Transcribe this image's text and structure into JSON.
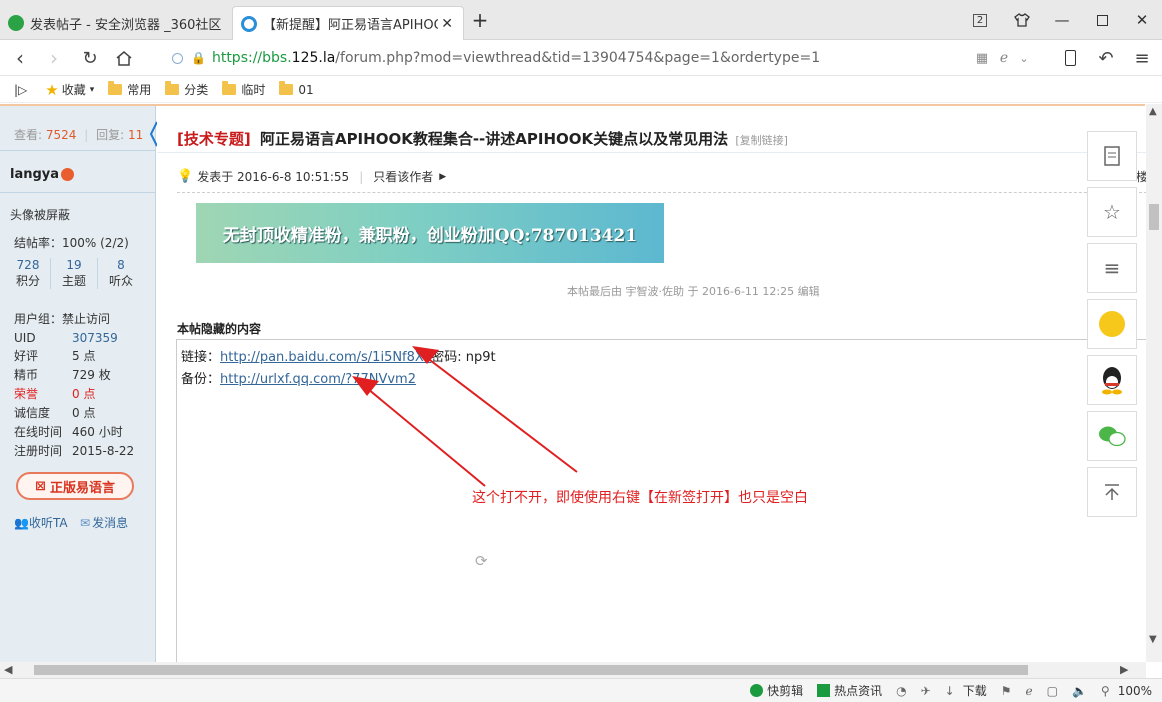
{
  "browser": {
    "tabs": [
      {
        "title": "发表帖子 - 安全浏览器 _360社区",
        "active": false
      },
      {
        "title": "【新提醒】阿正易语言APIHOOK",
        "active": true
      }
    ],
    "window_badge": "2",
    "url_prefix": "https://bbs.",
    "url_domain": "125.la",
    "url_rest": "/forum.php?mod=viewthread&tid=13904754&page=1&ordertype=1",
    "bookmarks": {
      "favorites_label": "收藏",
      "folders": [
        "常用",
        "分类",
        "临时",
        "01"
      ]
    }
  },
  "sidebar": {
    "views_label": "查看:",
    "views": "7524",
    "replies_label": "回复:",
    "replies": "11",
    "username": "langya",
    "avatar_text": "头像被屏蔽",
    "completion": "结帖率：100% (2/2)",
    "stats": [
      {
        "value": "728",
        "label": "积分"
      },
      {
        "value": "19",
        "label": "主题"
      },
      {
        "value": "8",
        "label": "听众"
      }
    ],
    "user_group": "用户组：禁止访问",
    "info": [
      {
        "k": "UID",
        "v": "307359",
        "link": true,
        "red": false
      },
      {
        "k": "好评",
        "v": "5 点",
        "link": false,
        "red": false
      },
      {
        "k": "精币",
        "v": "729 枚",
        "link": false,
        "red": false
      },
      {
        "k": "荣誉",
        "v": "0 点",
        "link": false,
        "red": true
      },
      {
        "k": "诚信度",
        "v": "0 点",
        "link": false,
        "red": false
      },
      {
        "k": "在线时间",
        "v": "460 小时",
        "link": false,
        "red": false
      },
      {
        "k": "注册时间",
        "v": "2015-8-22",
        "link": false,
        "red": false
      }
    ],
    "badge": "正版易语言",
    "follow": "收听TA",
    "message": "发消息"
  },
  "post": {
    "category": "[技术专题]",
    "title": "阿正易语言APIHOOK教程集合--讲述APIHOOK关键点以及常见用法",
    "copy_link": "[复制链接]",
    "posted_at": "发表于 2016-6-8 10:51:55",
    "only_author": "只看该作者",
    "floor_hint": "楼",
    "banner_text": "无封顶收精准粉，兼职粉，创业粉加QQ:787013421",
    "edit_note": "本帖最后由 宇智波·佐助 于 2016-6-11 12:25 编辑",
    "hidden_title": "本帖隐藏的内容",
    "link_label": "链接：",
    "link_url": "http://pan.baidu.com/s/1i5Nf8Xe",
    "password": "密码: np9t",
    "backup_label": "备份：",
    "backup_url": "http://urlxf.qq.com/?77NVvm2",
    "annotation": "这个打不开，即使使用右键【在新签打开】也只是空白"
  },
  "statusbar": {
    "items": [
      "快剪辑",
      "热点资讯",
      "下载",
      "100%"
    ]
  },
  "colors": {
    "annotation_red": "#e02020",
    "link_blue": "#336699",
    "sidebar_bg": "#e5edf2",
    "green": "#1b9a3f"
  }
}
